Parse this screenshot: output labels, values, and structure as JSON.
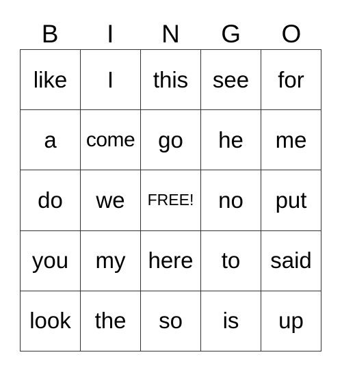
{
  "header": [
    "B",
    "I",
    "N",
    "G",
    "O"
  ],
  "cells": [
    [
      "like",
      "I",
      "this",
      "see",
      "for"
    ],
    [
      "a",
      "come",
      "go",
      "he",
      "me"
    ],
    [
      "do",
      "we",
      "FREE!",
      "no",
      "put"
    ],
    [
      "you",
      "my",
      "here",
      "to",
      "said"
    ],
    [
      "look",
      "the",
      "so",
      "is",
      "up"
    ]
  ]
}
